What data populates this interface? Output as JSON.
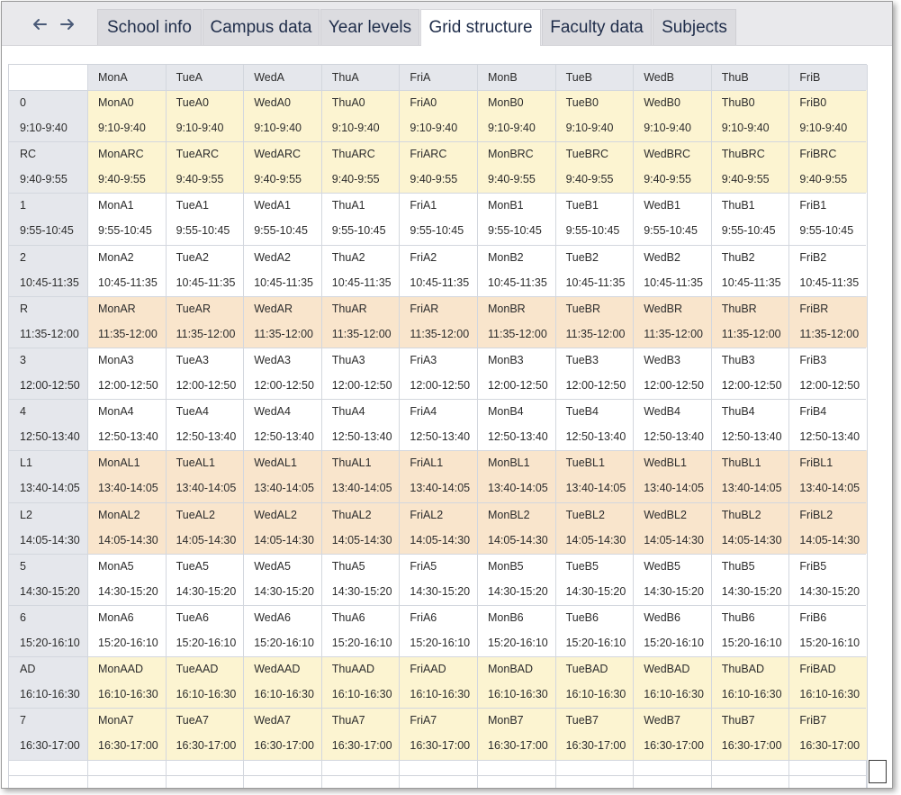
{
  "tabs": [
    {
      "label": "School info"
    },
    {
      "label": "Campus data"
    },
    {
      "label": "Year levels"
    },
    {
      "label": "Grid structure"
    },
    {
      "label": "Faculty data"
    },
    {
      "label": "Subjects"
    }
  ],
  "active_tab": "Grid structure",
  "colors": {
    "period": "#fcf4d1",
    "break": "#f9e5cc",
    "lesson": "#ffffff",
    "header": "#e5e7ec"
  },
  "columns": [
    "MonA",
    "TueA",
    "WedA",
    "ThuA",
    "FriA",
    "MonB",
    "TueB",
    "WedB",
    "ThuB",
    "FriB"
  ],
  "rows": [
    {
      "id": "0",
      "time": "9:10-9:40",
      "kind": "period"
    },
    {
      "id": "RC",
      "time": "9:40-9:55",
      "kind": "period"
    },
    {
      "id": "1",
      "time": "9:55-10:45",
      "kind": "lesson"
    },
    {
      "id": "2",
      "time": "10:45-11:35",
      "kind": "lesson"
    },
    {
      "id": "R",
      "time": "11:35-12:00",
      "kind": "break"
    },
    {
      "id": "3",
      "time": "12:00-12:50",
      "kind": "lesson"
    },
    {
      "id": "4",
      "time": "12:50-13:40",
      "kind": "lesson"
    },
    {
      "id": "L1",
      "time": "13:40-14:05",
      "kind": "break"
    },
    {
      "id": "L2",
      "time": "14:05-14:30",
      "kind": "break"
    },
    {
      "id": "5",
      "time": "14:30-15:20",
      "kind": "lesson"
    },
    {
      "id": "6",
      "time": "15:20-16:10",
      "kind": "lesson"
    },
    {
      "id": "AD",
      "time": "16:10-16:30",
      "kind": "period"
    },
    {
      "id": "7",
      "time": "16:30-17:00",
      "kind": "period"
    }
  ]
}
